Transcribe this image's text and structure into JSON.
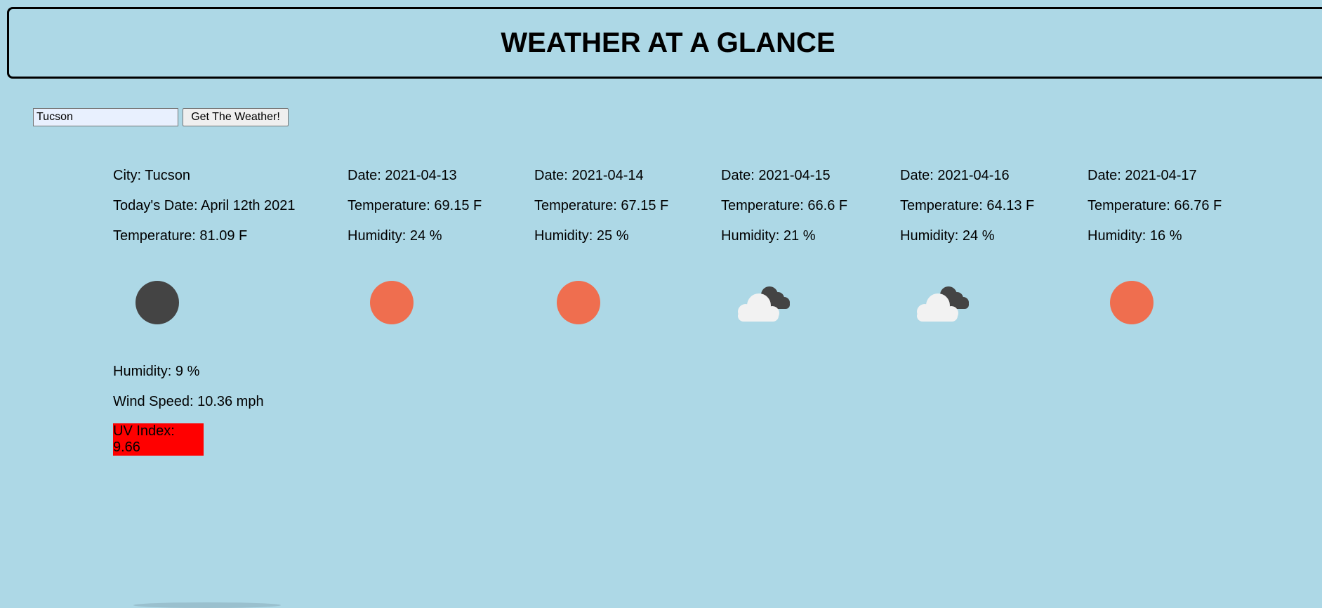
{
  "header": {
    "title": "WEATHER AT A GLANCE"
  },
  "search": {
    "value": "Tucson",
    "button_label": "Get The Weather!"
  },
  "current": {
    "city": "City: Tucson",
    "date": "Today's Date: April 12th 2021",
    "temperature": "Temperature: 81.09 F",
    "icon": "moon-icon",
    "humidity": "Humidity: 9 %",
    "wind": "Wind Speed: 10.36 mph",
    "uv_label": "UV Index:",
    "uv_value": "9.66",
    "uv_color": "#ff0000"
  },
  "forecast": [
    {
      "date": "Date: 2021-04-13",
      "temperature": "Temperature: 69.15 F",
      "humidity": "Humidity: 24 %",
      "icon": "sun-icon"
    },
    {
      "date": "Date: 2021-04-14",
      "temperature": "Temperature: 67.15 F",
      "humidity": "Humidity: 25 %",
      "icon": "sun-icon"
    },
    {
      "date": "Date: 2021-04-15",
      "temperature": "Temperature: 66.6 F",
      "humidity": "Humidity: 21 %",
      "icon": "clouds-icon"
    },
    {
      "date": "Date: 2021-04-16",
      "temperature": "Temperature: 64.13 F",
      "humidity": "Humidity: 24 %",
      "icon": "clouds-icon"
    },
    {
      "date": "Date: 2021-04-17",
      "temperature": "Temperature: 66.76 F",
      "humidity": "Humidity: 16 %",
      "icon": "sun-icon"
    }
  ],
  "colors": {
    "background": "#add8e6",
    "sun": "#ef6e4f",
    "moon": "#444444",
    "cloud_light": "#f2f2f2",
    "cloud_dark": "#444444"
  }
}
